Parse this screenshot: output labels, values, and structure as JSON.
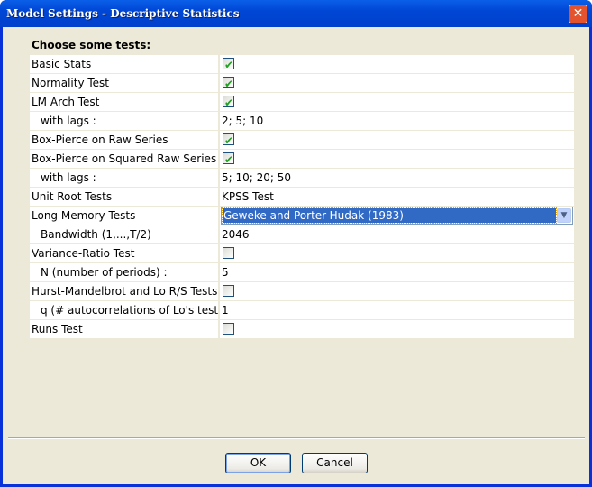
{
  "window": {
    "title": "Model Settings - Descriptive Statistics",
    "close": "✕"
  },
  "heading": "Choose some tests:",
  "rows": [
    {
      "label": "Basic Stats",
      "type": "checkbox",
      "checked": true
    },
    {
      "label": "Normality Test",
      "type": "checkbox",
      "checked": true
    },
    {
      "label": "LM Arch Test",
      "type": "checkbox",
      "checked": true
    },
    {
      "label": "with lags :",
      "type": "text",
      "value": "2; 5; 10",
      "sub": true
    },
    {
      "label": "Box-Pierce on Raw Series",
      "type": "checkbox",
      "checked": true
    },
    {
      "label": "Box-Pierce on Squared Raw Series",
      "type": "checkbox",
      "checked": true
    },
    {
      "label": "with lags :",
      "type": "text",
      "value": "5; 10; 20; 50",
      "sub": true
    },
    {
      "label": "Unit Root Tests",
      "type": "text",
      "value": "KPSS Test"
    },
    {
      "label": "Long Memory Tests",
      "type": "select",
      "value": "Geweke and Porter-Hudak (1983)"
    },
    {
      "label": "Bandwidth (1,...,T/2)",
      "type": "text",
      "value": "2046",
      "sub": true
    },
    {
      "label": "Variance-Ratio Test",
      "type": "checkbox",
      "checked": false
    },
    {
      "label": "N (number of periods) :",
      "type": "text",
      "value": "5",
      "sub": true
    },
    {
      "label": "Hurst-Mandelbrot and Lo R/S Tests",
      "type": "checkbox",
      "checked": false
    },
    {
      "label": "q (# autocorrelations of Lo's test)",
      "type": "text",
      "value": "1",
      "sub": true
    },
    {
      "label": "Runs Test",
      "type": "checkbox",
      "checked": false
    }
  ],
  "buttons": {
    "ok": "OK",
    "cancel": "Cancel"
  }
}
